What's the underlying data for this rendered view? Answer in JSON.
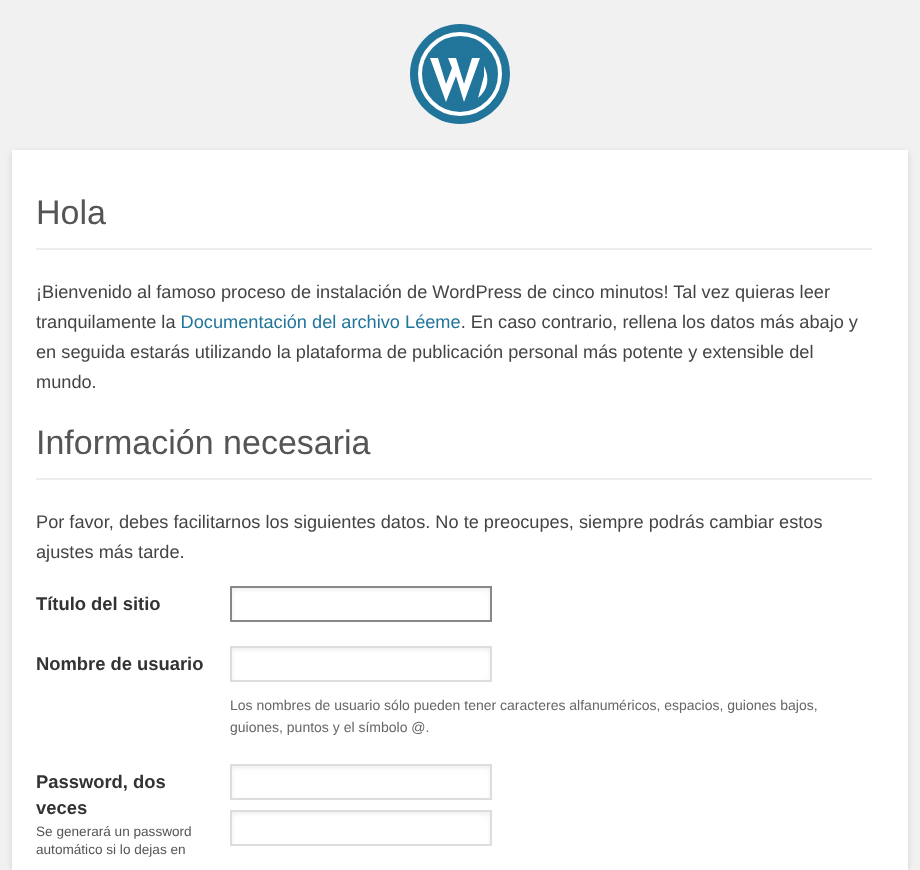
{
  "sections": [
    {
      "heading": "Hola",
      "text_before": "¡Bienvenido al famoso proceso de instalación de WordPress de cinco minutos! Tal vez quieras leer tranquilamente la ",
      "link": "Documentación del archivo Léeme",
      "text_after": ". En caso contrario, rellena los datos más abajo y en seguida estarás utilizando la plataforma de publicación personal más potente y extensible del mundo."
    },
    {
      "heading": "Información necesaria",
      "text_before": "Por favor, debes facilitarnos los siguientes datos. No te preocupes, siempre podrás cambiar estos ajustes más tarde."
    }
  ],
  "fields": [
    {
      "label": "Título del sitio",
      "inputs": [
        {
          "focused": true
        }
      ]
    },
    {
      "label": "Nombre de usuario",
      "inputs": [
        {
          "focused": false
        }
      ],
      "hint": "Los nombres de usuario sólo pueden tener caracteres alfanuméricos, espacios, guiones bajos, guiones, puntos y el símbolo @."
    },
    {
      "label": "Password, dos veces",
      "label_hint": "Se generará un password automático si lo dejas en",
      "inputs": [
        {
          "focused": false
        },
        {
          "focused": false
        }
      ]
    }
  ]
}
